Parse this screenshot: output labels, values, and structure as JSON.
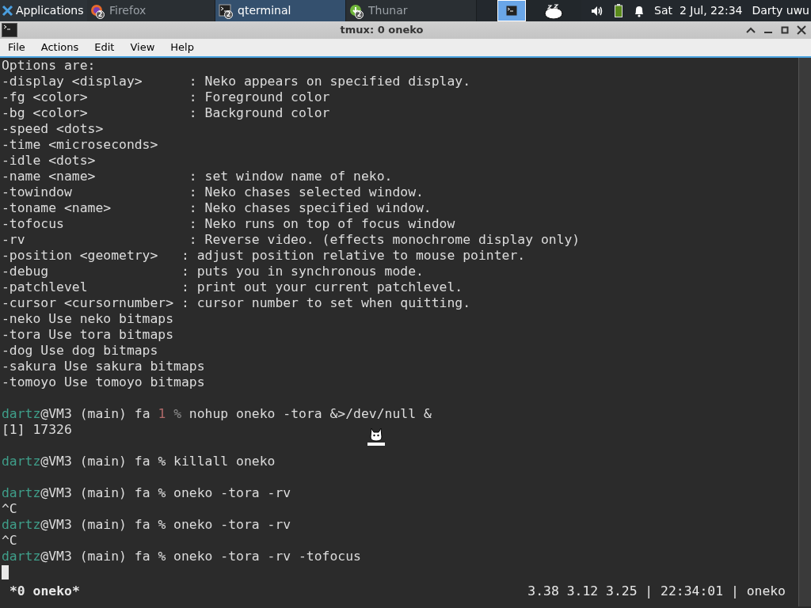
{
  "panel": {
    "app_menu": "Applications",
    "tasks": [
      {
        "label": "Firefox",
        "count": "2",
        "kind": "browser",
        "selected": false
      },
      {
        "label": "qterminal",
        "count": "2",
        "kind": "terminal",
        "selected": true
      },
      {
        "label": "Thunar",
        "count": "2",
        "kind": "files",
        "selected": false
      }
    ],
    "workspaces": [
      {
        "selected": true
      }
    ],
    "clock": "Sat  2 Jul, 22:34",
    "user": "Darty uwu"
  },
  "window": {
    "title": "tmux: 0 oneko",
    "menu": [
      "File",
      "Actions",
      "Edit",
      "View",
      "Help"
    ]
  },
  "terminal": {
    "lines": [
      {
        "kind": "output",
        "text": "Options are:"
      },
      {
        "kind": "output",
        "text": "-display <display>      : Neko appears on specified display."
      },
      {
        "kind": "output",
        "text": "-fg <color>             : Foreground color"
      },
      {
        "kind": "output",
        "text": "-bg <color>             : Background color"
      },
      {
        "kind": "output",
        "text": "-speed <dots>"
      },
      {
        "kind": "output",
        "text": "-time <microseconds>"
      },
      {
        "kind": "output",
        "text": "-idle <dots>"
      },
      {
        "kind": "output",
        "text": "-name <name>            : set window name of neko."
      },
      {
        "kind": "output",
        "text": "-towindow               : Neko chases selected window."
      },
      {
        "kind": "output",
        "text": "-toname <name>          : Neko chases specified window."
      },
      {
        "kind": "output",
        "text": "-tofocus                : Neko runs on top of focus window"
      },
      {
        "kind": "output",
        "text": "-rv                     : Reverse video. (effects monochrome display only)"
      },
      {
        "kind": "output",
        "text": "-position <geometry>   : adjust position relative to mouse pointer."
      },
      {
        "kind": "output",
        "text": "-debug                 : puts you in synchronous mode."
      },
      {
        "kind": "output",
        "text": "-patchlevel            : print out your current patchlevel."
      },
      {
        "kind": "output",
        "text": "-cursor <cursornumber> : cursor number to set when quitting."
      },
      {
        "kind": "output",
        "text": "-neko Use neko bitmaps"
      },
      {
        "kind": "output",
        "text": "-tora Use tora bitmaps"
      },
      {
        "kind": "output",
        "text": "-dog Use dog bitmaps"
      },
      {
        "kind": "output",
        "text": "-sakura Use sakura bitmaps"
      },
      {
        "kind": "output",
        "text": "-tomoyo Use tomoyo bitmaps"
      },
      {
        "kind": "blank"
      },
      {
        "kind": "prompt",
        "user": "dartz",
        "host": "@VM3 (main) fa",
        "exit_code": "1",
        "symbol": "%",
        "command": "nohup oneko -tora &>/dev/null &"
      },
      {
        "kind": "output",
        "text": "[1] 17326"
      },
      {
        "kind": "blank"
      },
      {
        "kind": "prompt",
        "user": "dartz",
        "host": "@VM3 (main) fa",
        "symbol": "%",
        "command": "killall oneko"
      },
      {
        "kind": "blank"
      },
      {
        "kind": "prompt",
        "user": "dartz",
        "host": "@VM3 (main) fa",
        "symbol": "%",
        "command": "oneko -tora -rv"
      },
      {
        "kind": "output",
        "text": "^C"
      },
      {
        "kind": "prompt",
        "user": "dartz",
        "host": "@VM3 (main) fa",
        "symbol": "%",
        "command": "oneko -tora -rv"
      },
      {
        "kind": "output",
        "text": "^C"
      },
      {
        "kind": "prompt",
        "user": "dartz",
        "host": "@VM3 (main) fa",
        "symbol": "%",
        "command": "oneko -tora -rv -tofocus"
      },
      {
        "kind": "cursor"
      }
    ]
  },
  "tmux_status": {
    "window": "*0 oneko*",
    "right": "3.38 3.12 3.25 | 22:34:01 | oneko"
  }
}
